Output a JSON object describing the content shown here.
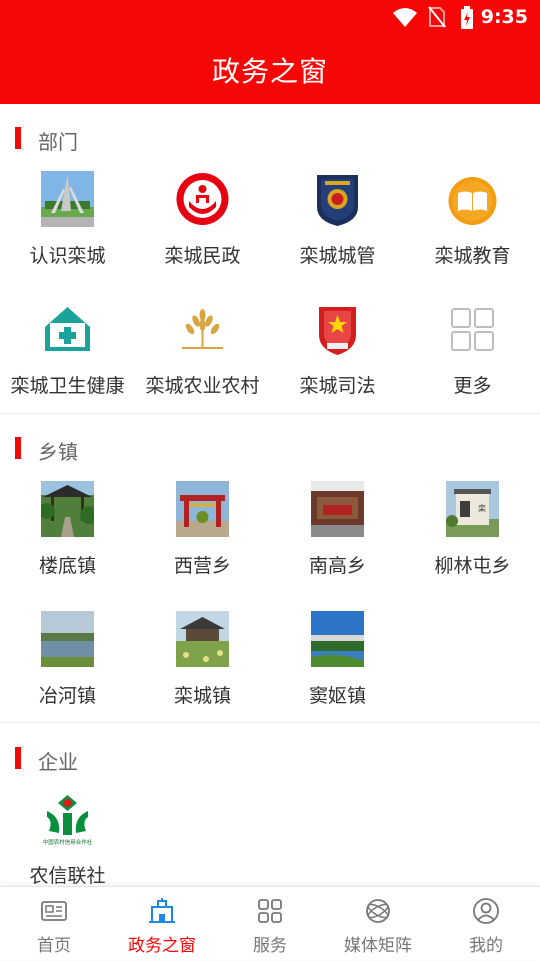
{
  "status_bar": {
    "time": "9:35"
  },
  "header": {
    "title": "政务之窗"
  },
  "sections": {
    "departments": {
      "title": "部门",
      "items": [
        {
          "label": "认识栾城",
          "icon": "monument-photo"
        },
        {
          "label": "栾城民政",
          "icon": "civil-affairs-logo"
        },
        {
          "label": "栾城城管",
          "icon": "city-management-badge"
        },
        {
          "label": "栾城教育",
          "icon": "book-icon"
        },
        {
          "label": "栾城卫生健康",
          "icon": "health-house-icon"
        },
        {
          "label": "栾城农业农村",
          "icon": "wheat-icon"
        },
        {
          "label": "栾城司法",
          "icon": "justice-emblem"
        },
        {
          "label": "更多",
          "icon": "grid-more-icon"
        }
      ]
    },
    "towns": {
      "title": "乡镇",
      "items": [
        {
          "label": "楼底镇",
          "icon": "pavilion-photo"
        },
        {
          "label": "西营乡",
          "icon": "red-gate-photo"
        },
        {
          "label": "南高乡",
          "icon": "wall-photo"
        },
        {
          "label": "柳林屯乡",
          "icon": "stone-gate-photo"
        },
        {
          "label": "冶河镇",
          "icon": "river-photo"
        },
        {
          "label": "栾城镇",
          "icon": "park-photo"
        },
        {
          "label": "窦妪镇",
          "icon": "lake-photo"
        }
      ]
    },
    "enterprises": {
      "title": "企业",
      "items": [
        {
          "label": "农信联社",
          "icon": "rural-credit-logo",
          "logo_text": "中国农村信用合作社"
        }
      ]
    }
  },
  "tabbar": {
    "active": "政务之窗",
    "items": [
      {
        "label": "首页",
        "icon": "newspaper-icon"
      },
      {
        "label": "政务之窗",
        "icon": "government-building-icon"
      },
      {
        "label": "服务",
        "icon": "grid-icon"
      },
      {
        "label": "媒体矩阵",
        "icon": "globe-icon"
      },
      {
        "label": "我的",
        "icon": "user-icon"
      }
    ]
  },
  "colors": {
    "brand_red": "#f70606",
    "active_blue": "#1e88e5",
    "text": "#333333",
    "muted": "#777777"
  }
}
